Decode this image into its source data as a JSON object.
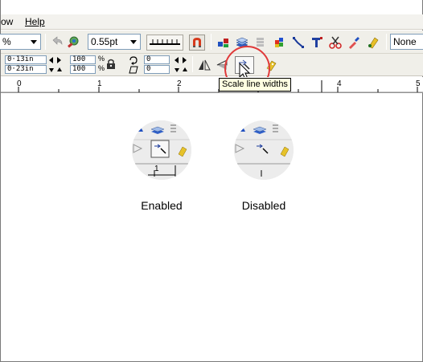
{
  "menu": {
    "partial_item": "ow",
    "help_label": "Help"
  },
  "toolbar1": {
    "percent_combo": "%",
    "line_width_combo": "0.55pt",
    "none_combo": "None"
  },
  "toolbar2": {
    "fields": {
      "x_value": "0·13in",
      "y_value": "0·23in",
      "scale_w": "100",
      "scale_h": "100",
      "percent_top": "%",
      "percent_bottom": "%",
      "rotate_value": "0",
      "skew_value": "0"
    }
  },
  "ruler": {
    "labels": [
      "0",
      "1",
      "2",
      "4",
      "5"
    ]
  },
  "tooltip": {
    "text": "Scale line widths"
  },
  "examples": {
    "enabled_label": "Enabled",
    "disabled_label": "Disabled",
    "ruler_digit": "1"
  },
  "colors": {
    "highlight_circle": "#e03a3a",
    "tooltip_bg": "#ffffe1",
    "toolbar_bg": "#f0efe9"
  }
}
